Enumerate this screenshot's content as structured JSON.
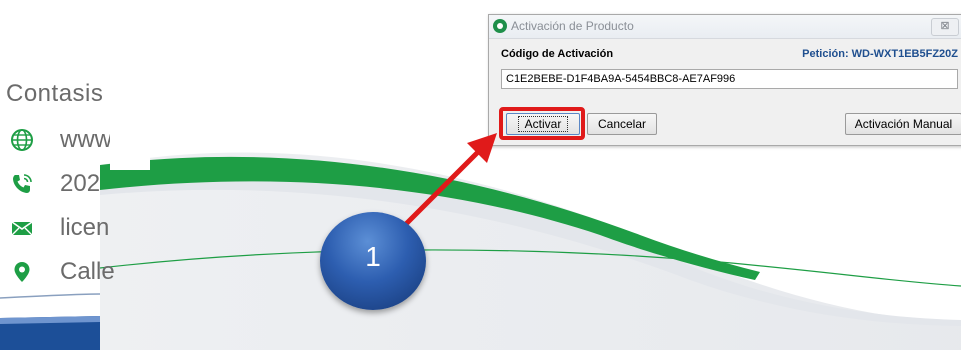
{
  "contact": {
    "title": "Contasis",
    "rows": [
      {
        "icon": "globe-icon",
        "text": "www"
      },
      {
        "icon": "phone-icon",
        "text": "202"
      },
      {
        "icon": "envelope-icon",
        "text": "licen"
      },
      {
        "icon": "location-pin-icon",
        "text": "Calle"
      }
    ]
  },
  "dialog": {
    "title": "Activación de Producto",
    "close_glyph": "⊠",
    "code_label": "Código de Activación",
    "request_label": "Petición: WD-WXT1EB5FZ20Z",
    "code_value": "C1E2BEBE-D1F4BA9A-5454BBC8-AE7AF996",
    "activate_label": "Activar",
    "cancel_label": "Cancelar",
    "manual_label": "Activación Manual"
  },
  "step_marker": {
    "number": "1"
  },
  "colors": {
    "accent_green": "#1e9e45",
    "highlight_red": "#e01a1a",
    "marker_blue": "#2d5eb0",
    "request_blue": "#1f4f8f"
  }
}
